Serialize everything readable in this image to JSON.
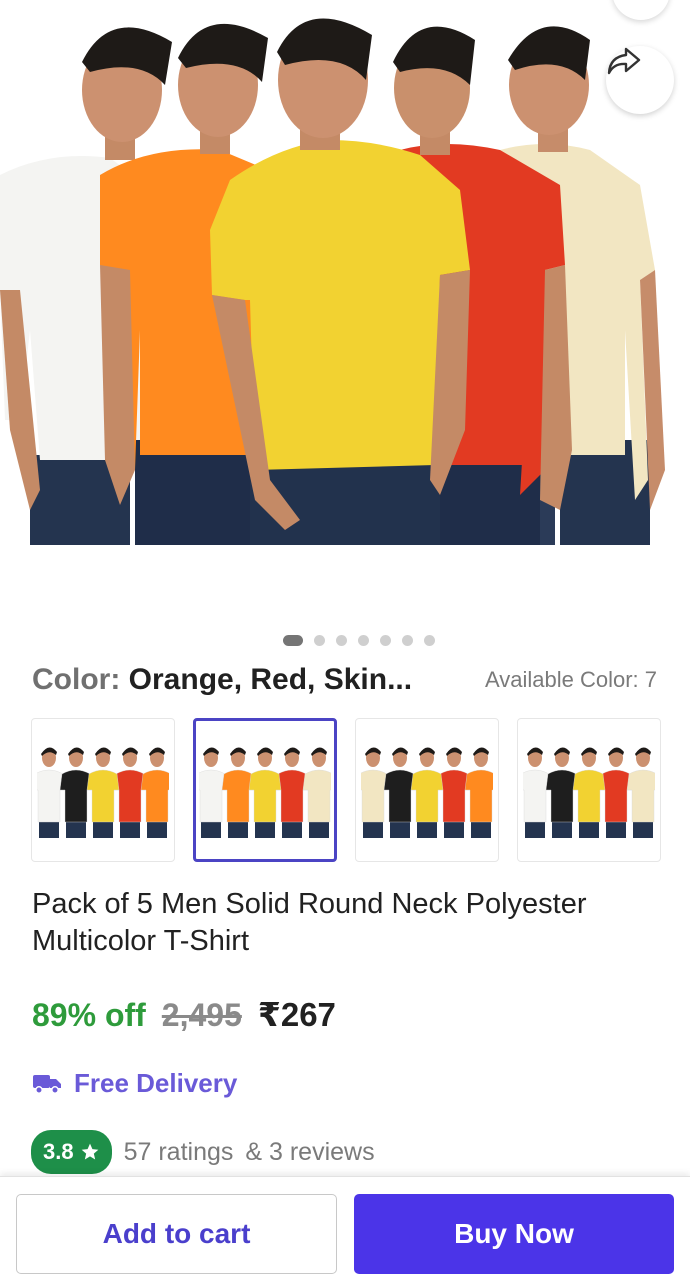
{
  "product": {
    "image_alt": "Five men wearing round neck t-shirts in white, orange, yellow, red and skin colors",
    "shirt_colors": [
      "#f4f4f2",
      "#ff8a1f",
      "#f2d231",
      "#e23a22",
      "#f2e6c2"
    ],
    "title": "Pack of 5 Men Solid Round Neck Polyester Multicolor T-Shirt"
  },
  "carousel": {
    "total": 7,
    "active_index": 0
  },
  "color": {
    "key_label": "Color:",
    "value": "Orange, Red, Skin...",
    "available_label": "Available Color: 7"
  },
  "variants": [
    {
      "colors": [
        "#f4f4f2",
        "#1e1e1e",
        "#f2d231",
        "#e23a22",
        "#ff8a1f"
      ],
      "selected": false
    },
    {
      "colors": [
        "#f4f4f2",
        "#ff8a1f",
        "#f2d231",
        "#e23a22",
        "#f2e6c2"
      ],
      "selected": true
    },
    {
      "colors": [
        "#f2e6c2",
        "#1e1e1e",
        "#f2d231",
        "#e23a22",
        "#ff8a1f"
      ],
      "selected": false
    },
    {
      "colors": [
        "#f4f4f2",
        "#1e1e1e",
        "#f2d231",
        "#e23a22",
        "#f2e6c2"
      ],
      "selected": false
    }
  ],
  "pricing": {
    "discount": "89% off",
    "mrp": "2,495",
    "price": "₹267"
  },
  "delivery": {
    "label": "Free Delivery",
    "icon": "truck-icon"
  },
  "rating": {
    "score": "3.8",
    "ratings": "57 ratings",
    "reviews": "& 3 reviews"
  },
  "actions": {
    "add_to_cart": "Add to cart",
    "buy_now": "Buy Now"
  },
  "colors": {
    "accent": "#4b34e8",
    "discount_green": "#2e9b3b",
    "rating_green": "#1e8f49",
    "delivery_purple": "#6a5ad8"
  }
}
